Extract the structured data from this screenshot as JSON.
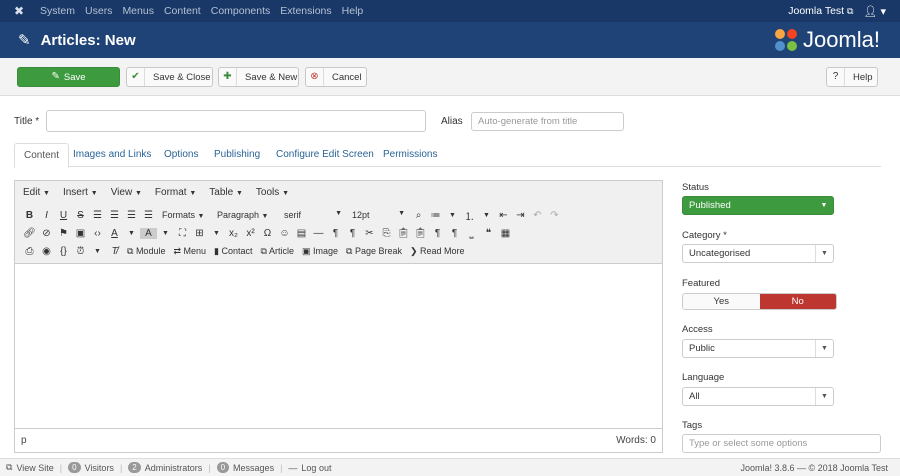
{
  "topbar": {
    "menu": [
      "System",
      "Users",
      "Menus",
      "Content",
      "Components",
      "Extensions",
      "Help"
    ],
    "site_name": "Joomla Test",
    "external_icon": "external-link-icon",
    "user_icon": "user-icon"
  },
  "header": {
    "title": "Articles: New",
    "brand": "Joomla!",
    "brand_colors": [
      "#f9a541",
      "#f44321",
      "#5091cd",
      "#7ac143"
    ]
  },
  "toolbar": {
    "save": "Save",
    "save_close": "Save & Close",
    "save_new": "Save & New",
    "cancel": "Cancel",
    "help": "Help"
  },
  "form": {
    "title_label": "Title *",
    "title_value": "",
    "alias_label": "Alias",
    "alias_placeholder": "Auto-generate from title"
  },
  "tabs": [
    "Content",
    "Images and Links",
    "Options",
    "Publishing",
    "Configure Edit Screen",
    "Permissions"
  ],
  "editor": {
    "menubar": [
      "Edit",
      "Insert",
      "View",
      "Format",
      "Table",
      "Tools"
    ],
    "formats_label": "Formats",
    "block_format": "Paragraph",
    "font_family": "serif",
    "font_size": "12pt",
    "buttons": [
      "Module",
      "Menu",
      "Contact",
      "Article",
      "Image",
      "Page Break",
      "Read More"
    ],
    "path": "p",
    "word_count": "Words: 0"
  },
  "sidebar": {
    "status_label": "Status",
    "status_value": "Published",
    "category_label": "Category *",
    "category_value": "Uncategorised",
    "featured_label": "Featured",
    "featured_yes": "Yes",
    "featured_no": "No",
    "access_label": "Access",
    "access_value": "Public",
    "language_label": "Language",
    "language_value": "All",
    "tags_label": "Tags",
    "tags_placeholder": "Type or select some options"
  },
  "footer": {
    "view_site": "View Site",
    "visitors_count": "0",
    "visitors": "Visitors",
    "admins_count": "2",
    "admins": "Administrators",
    "messages_count": "0",
    "messages": "Messages",
    "logout": "Log out",
    "copyright": "Joomla! 3.8.6 — © 2018 Joomla Test"
  },
  "colors": {
    "topbar": "#1a3867",
    "header": "#1f4277",
    "save": "#3e9a3e",
    "featured_no": "#bd362f"
  }
}
